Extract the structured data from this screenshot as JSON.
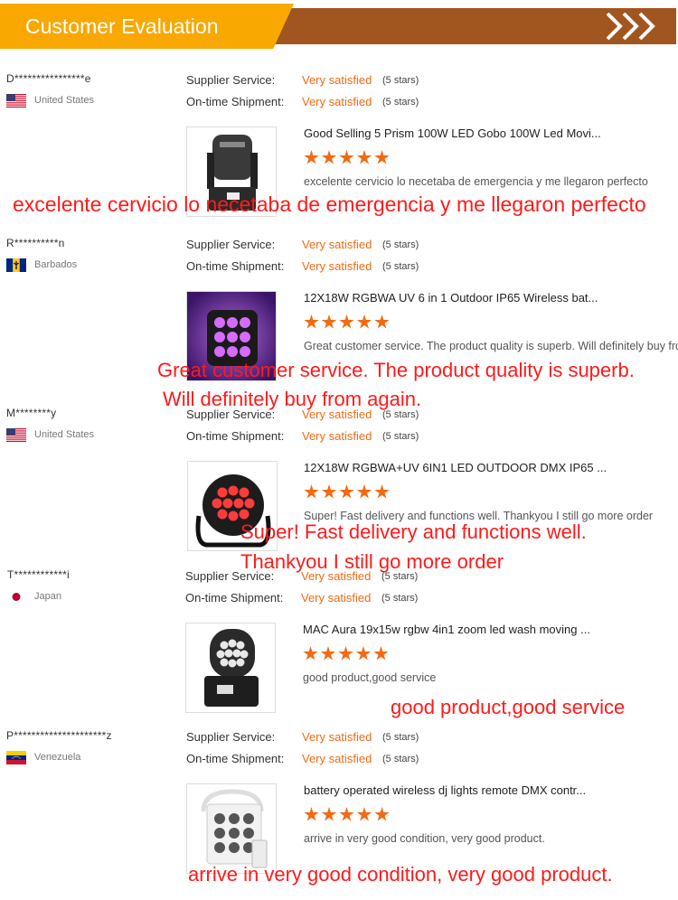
{
  "header": {
    "title": "Customer Evaluation"
  },
  "labels": {
    "supplier": "Supplier Service:",
    "shipment": "On-time Shipment:"
  },
  "reviews": [
    {
      "user": "D****************e",
      "country": "United States",
      "supplier_value": "Very satisfied",
      "supplier_stars": "(5 stars)",
      "shipment_value": "Very satisfied",
      "shipment_stars": "(5 stars)",
      "product": "Good Selling 5 Prism 100W LED Gobo 100W Led Movi...",
      "comment": "excelente cervicio lo necetaba de emergencia y me llegaron perfecto",
      "annotation": [
        "excelente cervicio lo necetaba de emergencia y me llegaron perfecto"
      ]
    },
    {
      "user": "R**********n",
      "country": "Barbados",
      "supplier_value": "Very satisfied",
      "supplier_stars": "(5 stars)",
      "shipment_value": "Very satisfied",
      "shipment_stars": "(5 stars)",
      "product": "12X18W RGBWA UV 6 in 1 Outdoor IP65 Wireless bat...",
      "comment": "Great customer service. The product quality is superb. Will definitely buy from again.",
      "annotation": [
        "Great customer service. The product quality is superb.",
        "Will definitely buy from again."
      ]
    },
    {
      "user": "M********y",
      "country": "United States",
      "supplier_value": "Very satisfied",
      "supplier_stars": "(5 stars)",
      "shipment_value": "Very satisfied",
      "shipment_stars": "(5 stars)",
      "product": "12X18W RGBWA+UV 6IN1 LED OUTDOOR DMX IP65 ...",
      "comment": "Super! Fast delivery and functions well. Thankyou I still go more order",
      "annotation": [
        "Super! Fast delivery and functions well.",
        "Thankyou I still go more order"
      ]
    },
    {
      "user": "T************i",
      "country": "Japan",
      "supplier_value": "Very satisfied",
      "supplier_stars": "(5 stars)",
      "shipment_value": "Very satisfied",
      "shipment_stars": "(5 stars)",
      "product": "MAC Aura 19x15w rgbw 4in1 zoom led wash moving ...",
      "comment": "good product,good service",
      "annotation": [
        "good product,good service"
      ]
    },
    {
      "user": "P*********************z",
      "country": "Venezuela",
      "supplier_value": "Very satisfied",
      "supplier_stars": "(5 stars)",
      "shipment_value": "Very satisfied",
      "shipment_stars": "(5 stars)",
      "product": "battery operated wireless dj lights remote DMX contr...",
      "comment": "arrive in very good condition, very good product.",
      "annotation": [
        "arrive in very good condition, very good product."
      ]
    }
  ],
  "colors": {
    "accent": "#f36a12",
    "header_tab": "#f8a800",
    "header_band": "#a1551f",
    "annotation": "#ff1a1a"
  },
  "icons": [
    "flag-usa-icon",
    "flag-barbados-icon",
    "flag-japan-icon",
    "flag-venezuela-icon",
    "star-icon",
    "chevron-right-icon"
  ]
}
